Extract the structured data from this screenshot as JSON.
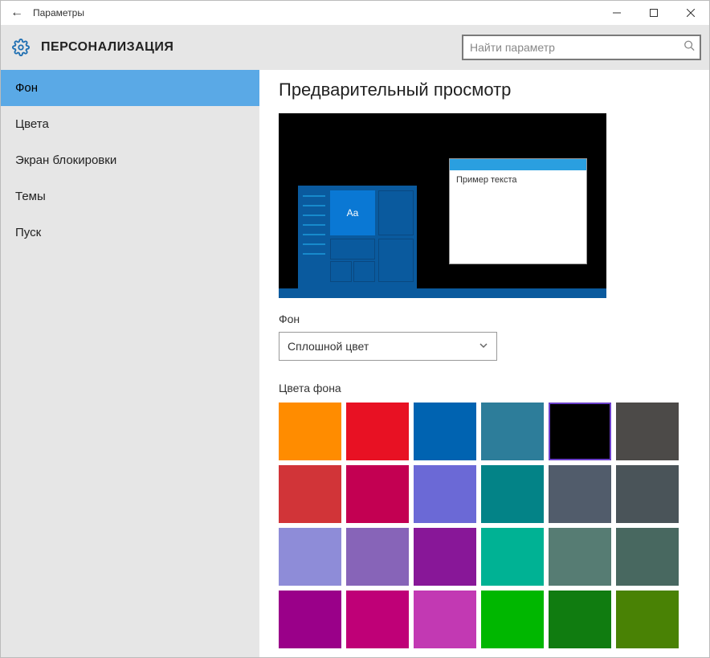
{
  "titlebar": {
    "back_icon": "←",
    "title": "Параметры"
  },
  "header": {
    "heading": "ПЕРСОНАЛИЗАЦИЯ",
    "search_placeholder": "Найти параметр"
  },
  "sidebar": {
    "items": [
      {
        "label": "Фон",
        "selected": true
      },
      {
        "label": "Цвета",
        "selected": false
      },
      {
        "label": "Экран блокировки",
        "selected": false
      },
      {
        "label": "Темы",
        "selected": false
      },
      {
        "label": "Пуск",
        "selected": false
      }
    ]
  },
  "main": {
    "preview_heading": "Предварительный просмотр",
    "preview_tile_text": "Aa",
    "preview_window_text": "Пример текста",
    "background_label": "Фон",
    "background_dropdown_value": "Сплошной цвет",
    "colors_label": "Цвета фона",
    "selected_color_index": 4,
    "colors": [
      "#ff8c00",
      "#e81123",
      "#0063b1",
      "#2d7d9a",
      "#000000",
      "#4c4a48",
      "#d13438",
      "#c30052",
      "#6b69d6",
      "#038387",
      "#515c6b",
      "#4a5459",
      "#8e8cd8",
      "#8764b8",
      "#881798",
      "#00b294",
      "#567c73",
      "#486860",
      "#9a0089",
      "#bf0077",
      "#c239b3",
      "#00b700",
      "#107c10",
      "#498205"
    ]
  }
}
